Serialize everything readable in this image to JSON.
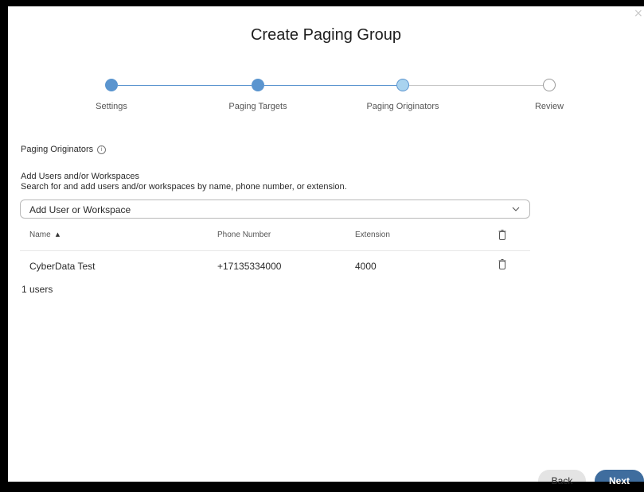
{
  "dialog": {
    "title": "Create Paging Group",
    "close_glyph": "×"
  },
  "stepper": {
    "steps": [
      {
        "label": "Settings",
        "state": "completed"
      },
      {
        "label": "Paging Targets",
        "state": "completed"
      },
      {
        "label": "Paging Originators",
        "state": "current"
      },
      {
        "label": "Review",
        "state": "upcoming"
      }
    ]
  },
  "section": {
    "label": "Paging Originators",
    "info_glyph": "i"
  },
  "add": {
    "heading": "Add Users and/or Workspaces",
    "description": "Search for and add users and/or workspaces by name, phone number, or extension.",
    "combo_value": "Add User or Workspace"
  },
  "table": {
    "columns": [
      "Name",
      "Phone Number",
      "Extension"
    ],
    "sort_glyph": "▲",
    "rows": [
      {
        "name": "CyberData Test",
        "phone": "+17135334000",
        "extension": "4000"
      }
    ]
  },
  "summary": {
    "count_text": "1 users"
  },
  "footer": {
    "back_label": "Back",
    "next_label": "Next"
  },
  "colors": {
    "accent": "#5b95cf",
    "current_step": "#a9d3ef",
    "next_button": "#3f6d9e"
  }
}
